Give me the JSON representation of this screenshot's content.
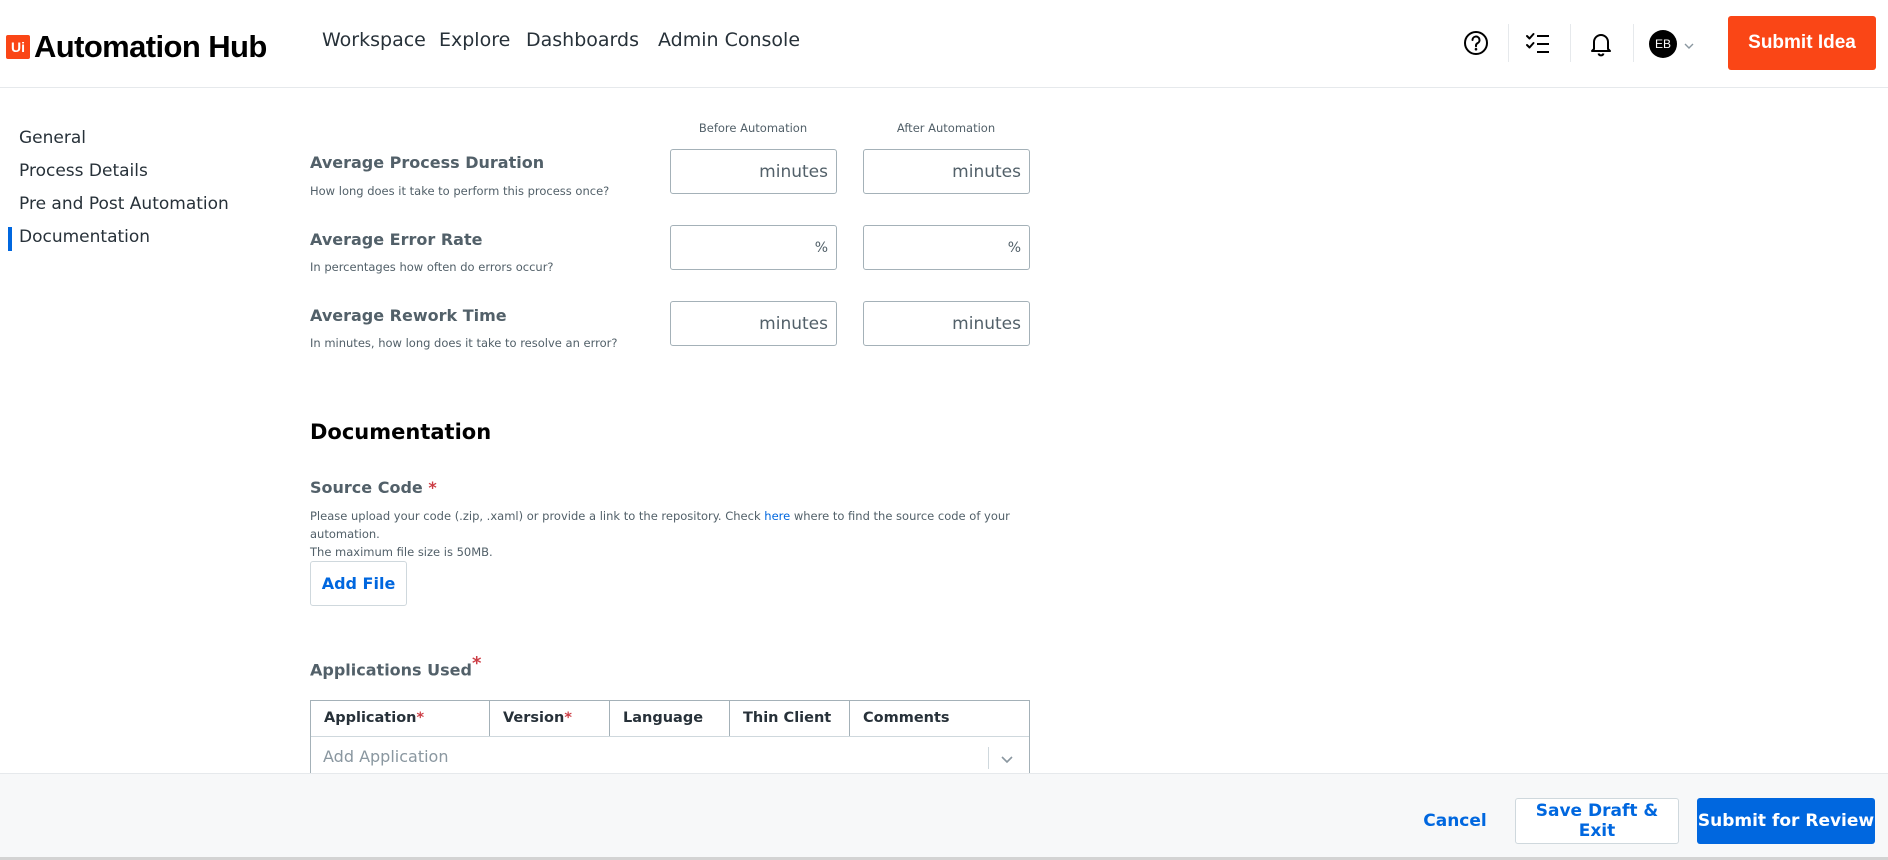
{
  "header": {
    "logo_badge": "Ui",
    "logo_text": "Automation Hub",
    "nav": [
      "Workspace",
      "Explore",
      "Dashboards",
      "Admin Console"
    ],
    "avatar_initials": "EB",
    "submit_idea_label": "Submit Idea",
    "icons": [
      "help-icon",
      "tasks-icon",
      "bell-icon",
      "chevron-down-icon"
    ],
    "accent_color": "#fa4616"
  },
  "sidenav": {
    "items": [
      "General",
      "Process Details",
      "Pre and Post Automation",
      "Documentation"
    ],
    "active": "Documentation",
    "active_color": "#0067df"
  },
  "metrics": {
    "col_before": "Before Automation",
    "col_after": "After Automation",
    "rows": [
      {
        "label": "Average Process Duration",
        "desc": "How long does it take to perform this process once?",
        "unit": "minutes"
      },
      {
        "label": "Average Error Rate",
        "desc": "In percentages how often do errors occur?",
        "unit": "%"
      },
      {
        "label": "Average Rework Time",
        "desc": "In minutes, how long does it take to resolve an error?",
        "unit": "minutes"
      }
    ]
  },
  "documentation": {
    "title": "Documentation",
    "source_code_label": "Source Code",
    "required_mark": "*",
    "help_part1": "Please upload your code (.zip, .xaml) or provide a link to the repository. Check ",
    "help_link": "here",
    "help_part2": " where to find the source code of your automation.",
    "help_line2": "The maximum file size is 50MB.",
    "add_file_label": "Add File",
    "apps_label": "Applications Used",
    "table": {
      "columns": [
        "Application",
        "Version",
        "Language",
        "Thin Client",
        "Comments"
      ],
      "required_columns": [
        "Application",
        "Version"
      ],
      "add_placeholder": "Add Application"
    }
  },
  "footer": {
    "cancel": "Cancel",
    "save_draft": "Save Draft & Exit",
    "submit_review": "Submit for Review"
  }
}
